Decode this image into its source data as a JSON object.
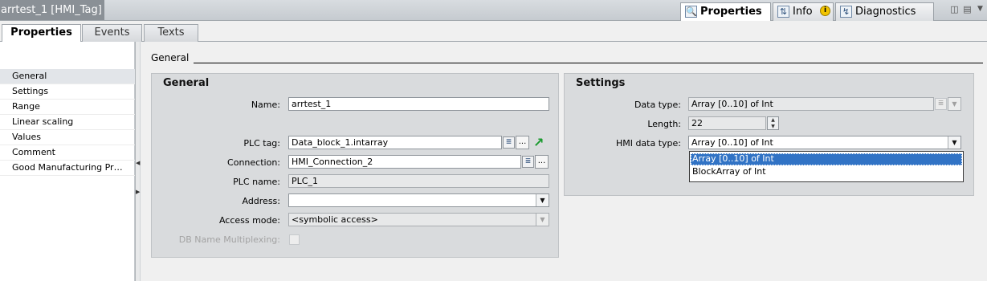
{
  "window": {
    "title": "arrtest_1 [HMI_Tag]",
    "top_tabs": [
      {
        "label": "Properties",
        "icon": "properties-icon"
      },
      {
        "label": "Info",
        "icon": "info-icon",
        "badge": "i"
      },
      {
        "label": "Diagnostics",
        "icon": "diagnostics-icon"
      }
    ]
  },
  "tabs": [
    "Properties",
    "Events",
    "Texts"
  ],
  "sidebar": {
    "items": [
      "General",
      "Settings",
      "Range",
      "Linear scaling",
      "Values",
      "Comment",
      "Good Manufacturing Pra..."
    ],
    "selected": 0
  },
  "section": {
    "title": "General"
  },
  "general_group": {
    "title": "General",
    "name_label": "Name:",
    "name_value": "arrtest_1",
    "plc_tag_label": "PLC tag:",
    "plc_tag_value": "Data_block_1.intarray",
    "connection_label": "Connection:",
    "connection_value": "HMI_Connection_2",
    "plc_name_label": "PLC name:",
    "plc_name_value": "PLC_1",
    "address_label": "Address:",
    "address_value": "",
    "access_mode_label": "Access mode:",
    "access_mode_value": "<symbolic access>",
    "db_multiplexing_label": "DB Name Multiplexing:",
    "browse_label": "...",
    "list_glyph": "≣"
  },
  "settings_group": {
    "title": "Settings",
    "data_type_label": "Data type:",
    "data_type_value": "Array [0..10] of Int",
    "length_label": "Length:",
    "length_value": "22",
    "hmi_data_type_label": "HMI data type:",
    "hmi_data_type_value": "Array [0..10] of Int",
    "hmi_data_type_options": [
      "Array [0..10] of Int",
      "BlockArray of Int"
    ],
    "hmi_data_type_selected": 0
  },
  "colors": {
    "accent": "#3173c5",
    "group_bg": "#d9dbdd",
    "goto_green": "#1a9a2e"
  }
}
